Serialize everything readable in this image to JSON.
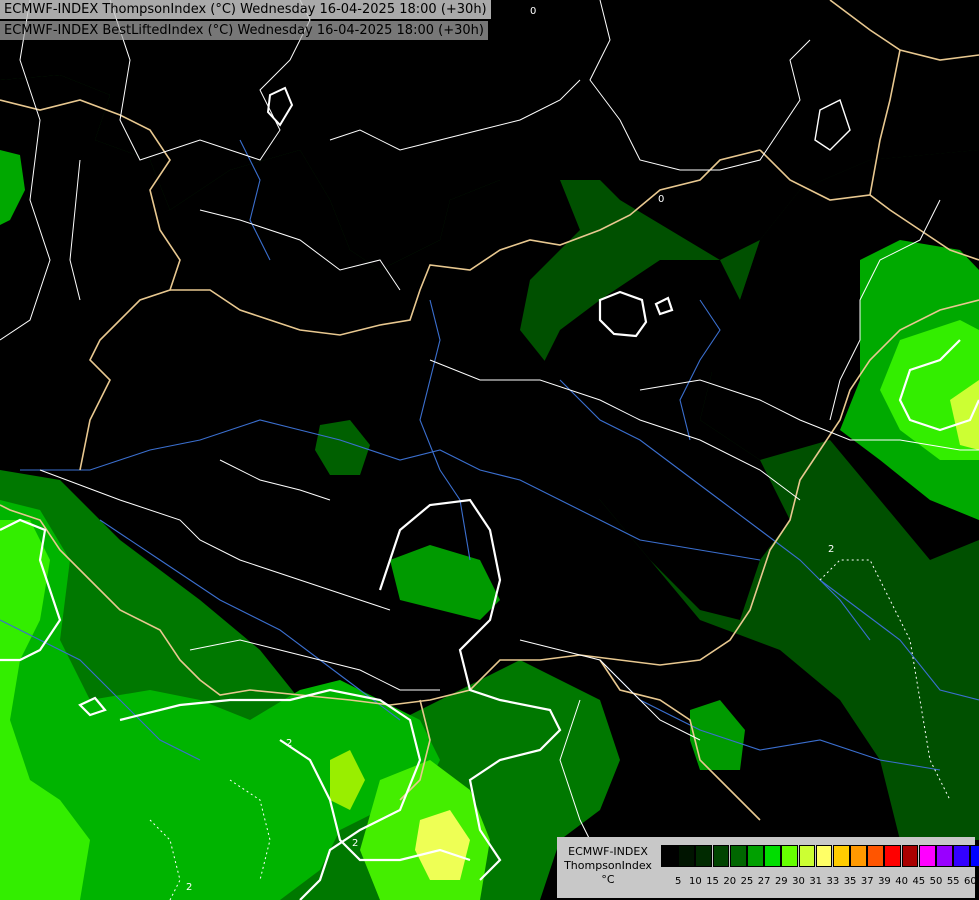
{
  "header": {
    "line1": "ECMWF-INDEX ThompsonIndex (°C) Wednesday 16-04-2025 18:00 (+30h)",
    "line2": "ECMWF-INDEX BestLiftedIndex (°C) Wednesday 16-04-2025 18:00 (+30h)"
  },
  "legend": {
    "title1": "ECMWF-INDEX",
    "title2": "ThompsonIndex",
    "unit": "°C",
    "labels": [
      "5",
      "10",
      "15",
      "20",
      "25",
      "27",
      "29",
      "30",
      "31",
      "33",
      "35",
      "37",
      "39",
      "40",
      "45",
      "50",
      "55",
      "60"
    ],
    "colors": [
      "#000000",
      "#001400",
      "#002a00",
      "#004400",
      "#006600",
      "#00a000",
      "#00dd00",
      "#66ff00",
      "#ccff33",
      "#ffff66",
      "#ffcc00",
      "#ff9900",
      "#ff5500",
      "#ff0000",
      "#aa0000",
      "#ff00ff",
      "#9900ff",
      "#3300ff",
      "#0000ff"
    ]
  },
  "contour_labels": [
    "0",
    "0",
    "2",
    "2",
    "2",
    "2"
  ],
  "colors": {
    "background": "#000000",
    "green_dark": "#005500",
    "green_mid": "#007700",
    "green_bright": "#00bb00",
    "green_lime": "#33ff00",
    "yellow": "#eeff55",
    "border": "#e8c890",
    "river": "#3b6fcf",
    "contour": "#ffffff"
  }
}
